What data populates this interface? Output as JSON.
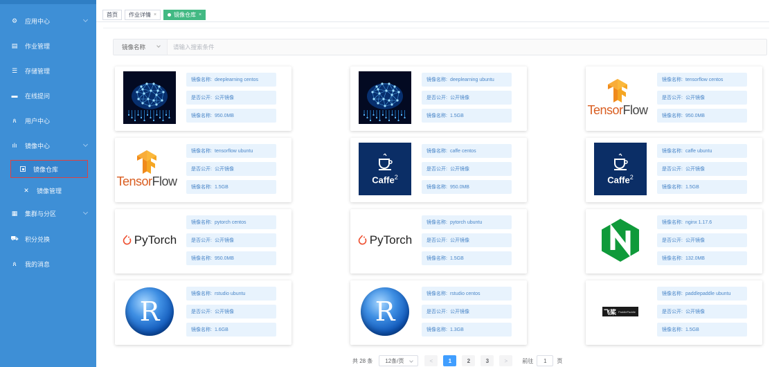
{
  "sidebar": {
    "items": [
      {
        "name": "app-center",
        "label": "应用中心",
        "icon": "gear-icon",
        "glyph": "⚙",
        "arrow": true
      },
      {
        "name": "job-management",
        "label": "作业管理",
        "icon": "document-icon",
        "glyph": "▤",
        "arrow": false
      },
      {
        "name": "storage-management",
        "label": "存储管理",
        "icon": "storage-icon",
        "glyph": "☰",
        "arrow": false
      },
      {
        "name": "online-questions",
        "label": "在线提问",
        "icon": "chat-icon",
        "glyph": "▬",
        "arrow": false
      },
      {
        "name": "user-center",
        "label": "用户中心",
        "icon": "user-icon",
        "glyph": "ጰ",
        "arrow": false
      },
      {
        "name": "image-center",
        "label": "镜像中心",
        "icon": "bar-chart-icon",
        "glyph": "ılı",
        "arrow": true
      },
      {
        "name": "image-repository",
        "label": "镜像仓库",
        "icon": "square-dot-icon",
        "glyph": "",
        "arrow": false
      },
      {
        "name": "image-management",
        "label": "镜像管理",
        "icon": "tools-icon",
        "glyph": "✕",
        "arrow": false
      },
      {
        "name": "cluster-partition",
        "label": "集群与分区",
        "icon": "server-icon",
        "glyph": "▦",
        "arrow": true
      },
      {
        "name": "points-exchange",
        "label": "积分兑换",
        "icon": "cart-icon",
        "glyph": "⛟",
        "arrow": false
      },
      {
        "name": "my-messages",
        "label": "我的消息",
        "icon": "user-message-icon",
        "glyph": "ጰ",
        "arrow": false
      }
    ]
  },
  "tabs": [
    {
      "label": "首页",
      "closable": false
    },
    {
      "label": "作业详情",
      "closable": true
    },
    {
      "label": "镜像仓库",
      "closable": true,
      "active": true
    }
  ],
  "close_glyph": "×",
  "search": {
    "select_label": "镜像名称",
    "placeholder": "请输入搜索条件"
  },
  "field_keys": {
    "name": "镜像名称:",
    "public": "是否公开:"
  },
  "cards": [
    {
      "logo": "brain",
      "name": "deeplearning centos",
      "public": "公开镜像",
      "size": "950.0MB"
    },
    {
      "logo": "brain",
      "name": "deeplearning ubuntu",
      "public": "公开镜像",
      "size": "1.5GB"
    },
    {
      "logo": "tensorflow",
      "name": "tensorflow centos",
      "public": "公开镜像",
      "size": "950.0MB"
    },
    {
      "logo": "tensorflow",
      "name": "tensorflow ubuntu",
      "public": "公开镜像",
      "size": "1.5GB"
    },
    {
      "logo": "caffe2",
      "name": "caffe centos",
      "public": "公开镜像",
      "size": "950.0MB"
    },
    {
      "logo": "caffe2",
      "name": "caffe ubuntu",
      "public": "公开镜像",
      "size": "1.5GB"
    },
    {
      "logo": "pytorch",
      "name": "pytorch centos",
      "public": "公开镜像",
      "size": "950.0MB"
    },
    {
      "logo": "pytorch",
      "name": "pytorch ubuntu",
      "public": "公开镜像",
      "size": "1.5GB"
    },
    {
      "logo": "nginx",
      "name": "nginx 1.17.6",
      "public": "公开镜像",
      "size": "132.0MB"
    },
    {
      "logo": "r",
      "name": "rstudio ubuntu",
      "public": "公开镜像",
      "size": "1.6GB"
    },
    {
      "logo": "r",
      "name": "rstudio centos",
      "public": "公开镜像",
      "size": "1.3GB"
    },
    {
      "logo": "paddle",
      "name": "paddlepaddle ubuntu",
      "public": "公开镜像",
      "size": "1.5GB"
    }
  ],
  "logo_text": {
    "tensorflow": "TensorFlow",
    "caffe2_main": "Caffe",
    "caffe2_sup": "2",
    "pytorch": "PyTorch",
    "r": "R",
    "nginx": "N",
    "paddle_mark": "飞桨",
    "paddle_text": "PaddlePaddle"
  },
  "pagination": {
    "total": "共 28 条",
    "page_size": "12条/页",
    "prev": "<",
    "next": ">",
    "pages": [
      "1",
      "2",
      "3"
    ],
    "current": "1",
    "goto_label": "前往",
    "goto_value": "1",
    "page_unit": "页"
  },
  "colors": {
    "sidebar": "#3e8fd6",
    "active_tab": "#42b983",
    "field_bg": "#e8f3fd",
    "field_text": "#4a86c8",
    "pager_active": "#409eff",
    "highlight_border": "#e0403f"
  }
}
